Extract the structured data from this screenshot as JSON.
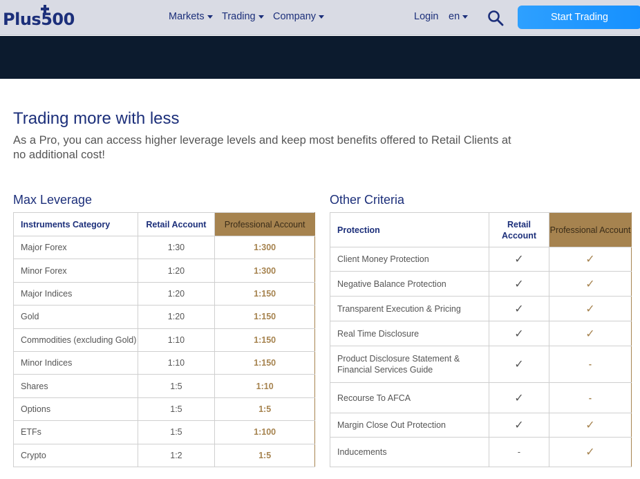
{
  "header": {
    "logo_text": "Plus500",
    "nav": [
      {
        "label": "Markets"
      },
      {
        "label": "Trading"
      },
      {
        "label": "Company"
      }
    ],
    "login": "Login",
    "language": "en",
    "cta": "Start Trading"
  },
  "intro": {
    "title": "Trading more with less",
    "text": "As a Pro, you can access higher leverage levels and keep most benefits offered to Retail Clients at no additional cost!"
  },
  "leverage": {
    "title": "Max Leverage",
    "headers": [
      "Instruments Category",
      "Retail Account",
      "Professional Account"
    ],
    "rows": [
      {
        "category": "Major Forex",
        "retail": "1:30",
        "professional": "1:300"
      },
      {
        "category": "Minor Forex",
        "retail": "1:20",
        "professional": "1:300"
      },
      {
        "category": "Major Indices",
        "retail": "1:20",
        "professional": "1:150"
      },
      {
        "category": "Gold",
        "retail": "1:20",
        "professional": "1:150"
      },
      {
        "category": "Commodities (excluding Gold)",
        "retail": "1:10",
        "professional": "1:150"
      },
      {
        "category": "Minor Indices",
        "retail": "1:10",
        "professional": "1:150"
      },
      {
        "category": "Shares",
        "retail": "1:5",
        "professional": "1:10"
      },
      {
        "category": "Options",
        "retail": "1:5",
        "professional": "1:5"
      },
      {
        "category": "ETFs",
        "retail": "1:5",
        "professional": "1:100"
      },
      {
        "category": "Crypto",
        "retail": "1:2",
        "professional": "1:5"
      }
    ]
  },
  "criteria": {
    "title": "Other Criteria",
    "headers": [
      "Protection",
      "Retail Account",
      "Professional Account"
    ],
    "rows": [
      {
        "name": "Client Money Protection",
        "retail": "✓",
        "professional": "✓"
      },
      {
        "name": "Negative Balance Protection",
        "retail": "✓",
        "professional": "✓"
      },
      {
        "name": "Transparent Execution & Pricing",
        "retail": "✓",
        "professional": "✓"
      },
      {
        "name": "Real Time Disclosure",
        "retail": "✓",
        "professional": "✓"
      },
      {
        "name": "Product Disclosure Statement & Financial Services Guide",
        "retail": "✓",
        "professional": "-"
      },
      {
        "name": "Recourse To AFCA",
        "retail": "✓",
        "professional": "-"
      },
      {
        "name": "Margin Close Out Protection",
        "retail": "✓",
        "professional": "✓"
      },
      {
        "name": "Inducements",
        "retail": "-",
        "professional": "✓"
      }
    ]
  }
}
